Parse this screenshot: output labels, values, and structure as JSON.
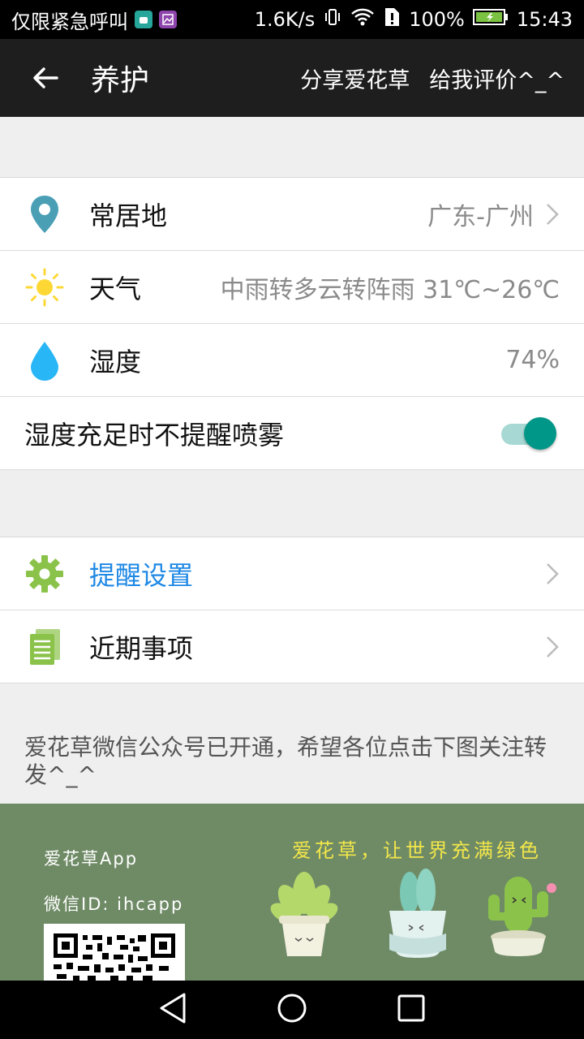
{
  "status_bar": {
    "carrier_text": "仅限紧急呼叫",
    "net_speed": "1.6K/s",
    "battery": "100%",
    "time": "15:43"
  },
  "app_bar": {
    "title": "养护",
    "share_label": "分享爱花草",
    "rate_label": "给我评价^_^"
  },
  "info": {
    "location_label": "常居地",
    "location_value": "广东-广州",
    "weather_label": "天气",
    "weather_value": "中雨转多云转阵雨 31℃~26℃",
    "humidity_label": "湿度",
    "humidity_value": "74%",
    "mist_toggle_label": "湿度充足时不提醒喷雾",
    "mist_toggle_on": true
  },
  "menu": {
    "reminder_label": "提醒设置",
    "recent_label": "近期事项"
  },
  "notice": "爱花草微信公众号已开通，希望各位点击下图关注转发^_^",
  "banner": {
    "app_name": "爱花草App",
    "wechat_id": "微信ID: ihcapp",
    "slogan": "爱花草，让世界充满绿色"
  },
  "colors": {
    "accent": "#009688",
    "link_blue": "#1e88e5",
    "gear_green": "#8bc34a",
    "location_teal": "#4a9fb5",
    "sun_yellow": "#fdd835",
    "drop_blue": "#29b6f6",
    "banner_green": "#6f8b66"
  }
}
